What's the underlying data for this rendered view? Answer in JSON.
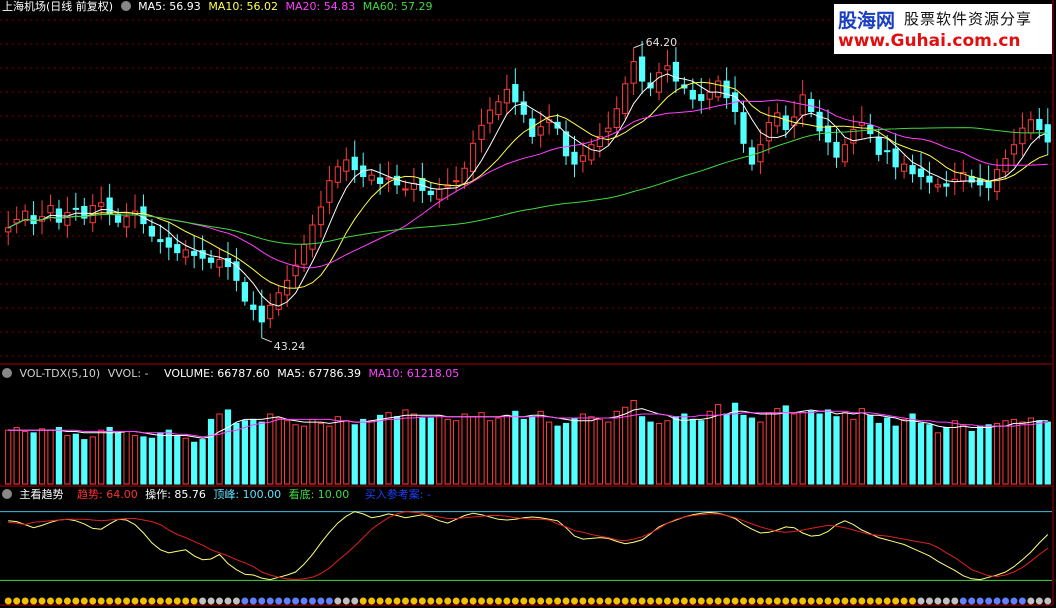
{
  "main_header": {
    "stock": "上海机场(日线 前复权)",
    "ma5": "MA5: 56.93",
    "ma10": "MA10: 56.02",
    "ma20": "MA20: 54.83",
    "ma60": "MA60: 57.29"
  },
  "vol_header": {
    "name": "VOL-TDX(5,10)",
    "vvol": "VVOL: -",
    "volume": "VOLUME: 66787.60",
    "ma5": "MA5: 67786.39",
    "ma10": "MA10: 61218.05"
  },
  "ind_header": {
    "name": "主看趋势",
    "trend": "趋势: 64.00",
    "op": "操作: 85.76",
    "peak": "顶峰: 100.00",
    "bottom": "看底: 10.00",
    "buy": "买入参考案: -"
  },
  "logo": {
    "name": "股海网",
    "tagline": "股票软件资源分享",
    "url": "www.Guhai.com.cn"
  },
  "colors": {
    "up": "#ff3c3c",
    "down": "#54ffff",
    "ma5": "#ffffff",
    "ma10": "#ffff4c",
    "ma20": "#ff40ff",
    "ma60": "#40d840",
    "grid": "#7a0000",
    "divider": "#b00000"
  },
  "chart_data": [
    {
      "type": "candlestick",
      "title": "上海机场(日线 前复权)",
      "annotations": [
        {
          "label": "64.20",
          "type": "high"
        },
        {
          "label": "43.24",
          "type": "low"
        }
      ],
      "close": [
        51.2,
        51.8,
        52.4,
        51.5,
        52.0,
        52.8,
        51.6,
        52.3,
        52.6,
        51.9,
        52.8,
        53.0,
        52.2,
        51.6,
        52.0,
        52.4,
        51.5,
        50.6,
        50.2,
        49.8,
        49.4,
        49.6,
        49.2,
        49.0,
        48.7,
        48.9,
        48.4,
        47.4,
        45.9,
        45.3,
        44.4,
        45.6,
        46.5,
        47.4,
        48.5,
        50.0,
        51.4,
        52.7,
        54.6,
        55.6,
        56.1,
        55.4,
        54.9,
        55.0,
        54.4,
        54.8,
        54.3,
        54.0,
        54.4,
        53.9,
        53.6,
        54.0,
        54.3,
        54.6,
        55.5,
        57.3,
        58.6,
        59.7,
        60.3,
        61.2,
        60.3,
        59.4,
        57.8,
        58.5,
        59.0,
        58.4,
        56.4,
        55.8,
        56.4,
        57.2,
        57.8,
        58.4,
        59.8,
        61.6,
        63.2,
        61.8,
        61.3,
        62.4,
        62.9,
        61.8,
        61.3,
        60.5,
        60.4,
        61.0,
        61.8,
        60.6,
        59.6,
        57.3,
        55.8,
        57.2,
        58.8,
        59.5,
        58.3,
        59.2,
        60.8,
        59.6,
        58.2,
        57.4,
        56.3,
        57.2,
        58.3,
        58.8,
        58.0,
        56.5,
        56.7,
        55.6,
        55.8,
        55.1,
        54.9,
        54.5,
        54.3,
        54.2,
        54.7,
        55.2,
        54.5,
        54.3,
        54.1,
        55.4,
        56.2,
        57.2,
        58.4,
        59.0,
        58.3,
        57.4
      ],
      "volume": [
        40,
        42,
        39,
        38,
        41,
        40,
        42,
        36,
        37,
        33,
        35,
        40,
        42,
        38,
        39,
        36,
        35,
        34,
        38,
        40,
        36,
        34,
        31,
        33,
        48,
        52,
        55,
        45,
        47,
        48,
        46,
        52,
        49,
        47,
        44,
        43,
        48,
        45,
        43,
        50,
        47,
        44,
        48,
        47,
        51,
        53,
        50,
        55,
        52,
        49,
        49,
        51,
        48,
        47,
        52,
        50,
        53,
        47,
        49,
        51,
        54,
        48,
        50,
        54,
        46,
        43,
        45,
        49,
        52,
        50,
        48,
        46,
        54,
        57,
        62,
        50,
        46,
        45,
        47,
        50,
        52,
        48,
        47,
        54,
        59,
        52,
        60,
        51,
        49,
        46,
        53,
        56,
        58,
        52,
        53,
        54,
        52,
        55,
        50,
        53,
        48,
        56,
        51,
        45,
        49,
        43,
        48,
        52,
        45,
        44,
        38,
        42,
        47,
        44,
        39,
        43,
        44,
        45,
        47,
        48,
        46,
        49,
        47,
        46
      ],
      "volume_ma5": [
        40,
        40,
        40,
        40,
        40,
        40,
        40,
        39,
        39,
        38,
        38,
        38,
        38,
        38,
        39,
        39,
        38,
        37,
        36,
        36,
        36,
        36,
        35,
        34,
        35,
        39,
        42,
        46,
        48,
        48,
        48,
        49,
        50,
        48,
        47,
        46,
        46,
        46,
        45,
        46,
        47,
        46,
        46,
        47,
        48,
        49,
        50,
        51,
        51,
        51,
        51,
        51,
        50,
        50,
        50,
        50,
        50,
        50,
        50,
        51,
        50,
        50,
        51,
        51,
        50,
        49,
        48,
        47,
        47,
        47,
        49,
        49,
        50,
        52,
        55,
        56,
        54,
        52,
        51,
        48,
        47,
        48,
        48,
        49,
        51,
        52,
        54,
        54,
        53,
        52,
        52,
        52,
        53,
        53,
        54,
        55,
        54,
        54,
        52,
        53,
        52,
        53,
        51,
        51,
        50,
        49,
        47,
        47,
        46,
        45,
        43,
        42,
        42,
        43,
        42,
        42,
        42,
        43,
        43,
        45,
        45,
        46,
        47,
        47
      ],
      "volume_ma10": [
        40,
        40,
        40,
        40,
        40,
        40,
        40,
        40,
        40,
        39,
        39,
        39,
        39,
        39,
        39,
        39,
        38,
        38,
        38,
        38,
        37,
        37,
        36,
        35,
        36,
        37,
        39,
        40,
        42,
        44,
        45,
        46,
        48,
        48,
        48,
        48,
        48,
        48,
        48,
        47,
        47,
        46,
        46,
        46,
        47,
        48,
        48,
        49,
        49,
        50,
        50,
        50,
        50,
        50,
        50,
        50,
        50,
        50,
        50,
        50,
        50,
        50,
        50,
        50,
        50,
        49,
        49,
        49,
        49,
        49,
        49,
        49,
        49,
        50,
        51,
        52,
        52,
        52,
        51,
        50,
        50,
        50,
        51,
        51,
        51,
        52,
        52,
        53,
        53,
        53,
        53,
        53,
        53,
        53,
        53,
        53,
        54,
        54,
        54,
        54,
        53,
        53,
        53,
        52,
        51,
        50,
        49,
        48,
        47,
        47,
        46,
        46,
        45,
        44,
        44,
        43,
        43,
        43,
        43,
        43,
        44,
        44,
        45,
        46
      ],
      "price_range": [
        41.5,
        66.5
      ],
      "volume_range": [
        0,
        78
      ]
    },
    {
      "type": "line",
      "title": "主看趋势",
      "reference_lines": [
        100,
        10
      ],
      "ylim": [
        0,
        110
      ],
      "series": [
        {
          "name": "趋势",
          "values": [
            86,
            85,
            83,
            86,
            87,
            88,
            89,
            90,
            90,
            90,
            89,
            88,
            89,
            90,
            91,
            91,
            89,
            87,
            83,
            76,
            70,
            66,
            61,
            56,
            50,
            46,
            42,
            37,
            33,
            28,
            21,
            17,
            14,
            12,
            11,
            12,
            14,
            19,
            26,
            36,
            45,
            55,
            66,
            77,
            85,
            92,
            97,
            100,
            99,
            98,
            95,
            93,
            91,
            91,
            92,
            93,
            94,
            95,
            95,
            94,
            92,
            91,
            90,
            90,
            89,
            84,
            80,
            75,
            73,
            70,
            68,
            66,
            63,
            62,
            64,
            67,
            72,
            78,
            85,
            90,
            93,
            95,
            96,
            97,
            97,
            95,
            92,
            88,
            84,
            80,
            77,
            74,
            73,
            74,
            76,
            78,
            80,
            82,
            81,
            79,
            76,
            73,
            70,
            69,
            68,
            66,
            64,
            62,
            60,
            58,
            53,
            46,
            40,
            32,
            24,
            20,
            16,
            15,
            17,
            21,
            27,
            35,
            44,
            52
          ]
        },
        {
          "name": "操作",
          "values": [
            88,
            87,
            83,
            79,
            82,
            86,
            89,
            90,
            88,
            84,
            78,
            77,
            84,
            90,
            89,
            83,
            72,
            59,
            50,
            46,
            48,
            50,
            42,
            37,
            38,
            44,
            32,
            24,
            18,
            17,
            13,
            11,
            14,
            17,
            21,
            31,
            44,
            59,
            73,
            85,
            94,
            100,
            97,
            92,
            94,
            97,
            95,
            92,
            94,
            96,
            93,
            88,
            85,
            90,
            95,
            98,
            96,
            93,
            90,
            89,
            90,
            92,
            93,
            92,
            90,
            88,
            79,
            68,
            64,
            65,
            66,
            65,
            61,
            58,
            60,
            63,
            71,
            80,
            85,
            89,
            93,
            96,
            98,
            99,
            98,
            95,
            91,
            83,
            77,
            72,
            73,
            76,
            80,
            79,
            72,
            68,
            69,
            74,
            83,
            88,
            83,
            76,
            71,
            66,
            63,
            60,
            57,
            52,
            47,
            42,
            35,
            29,
            23,
            16,
            12,
            11,
            14,
            17,
            21,
            28,
            37,
            47,
            59,
            70
          ]
        }
      ]
    }
  ]
}
